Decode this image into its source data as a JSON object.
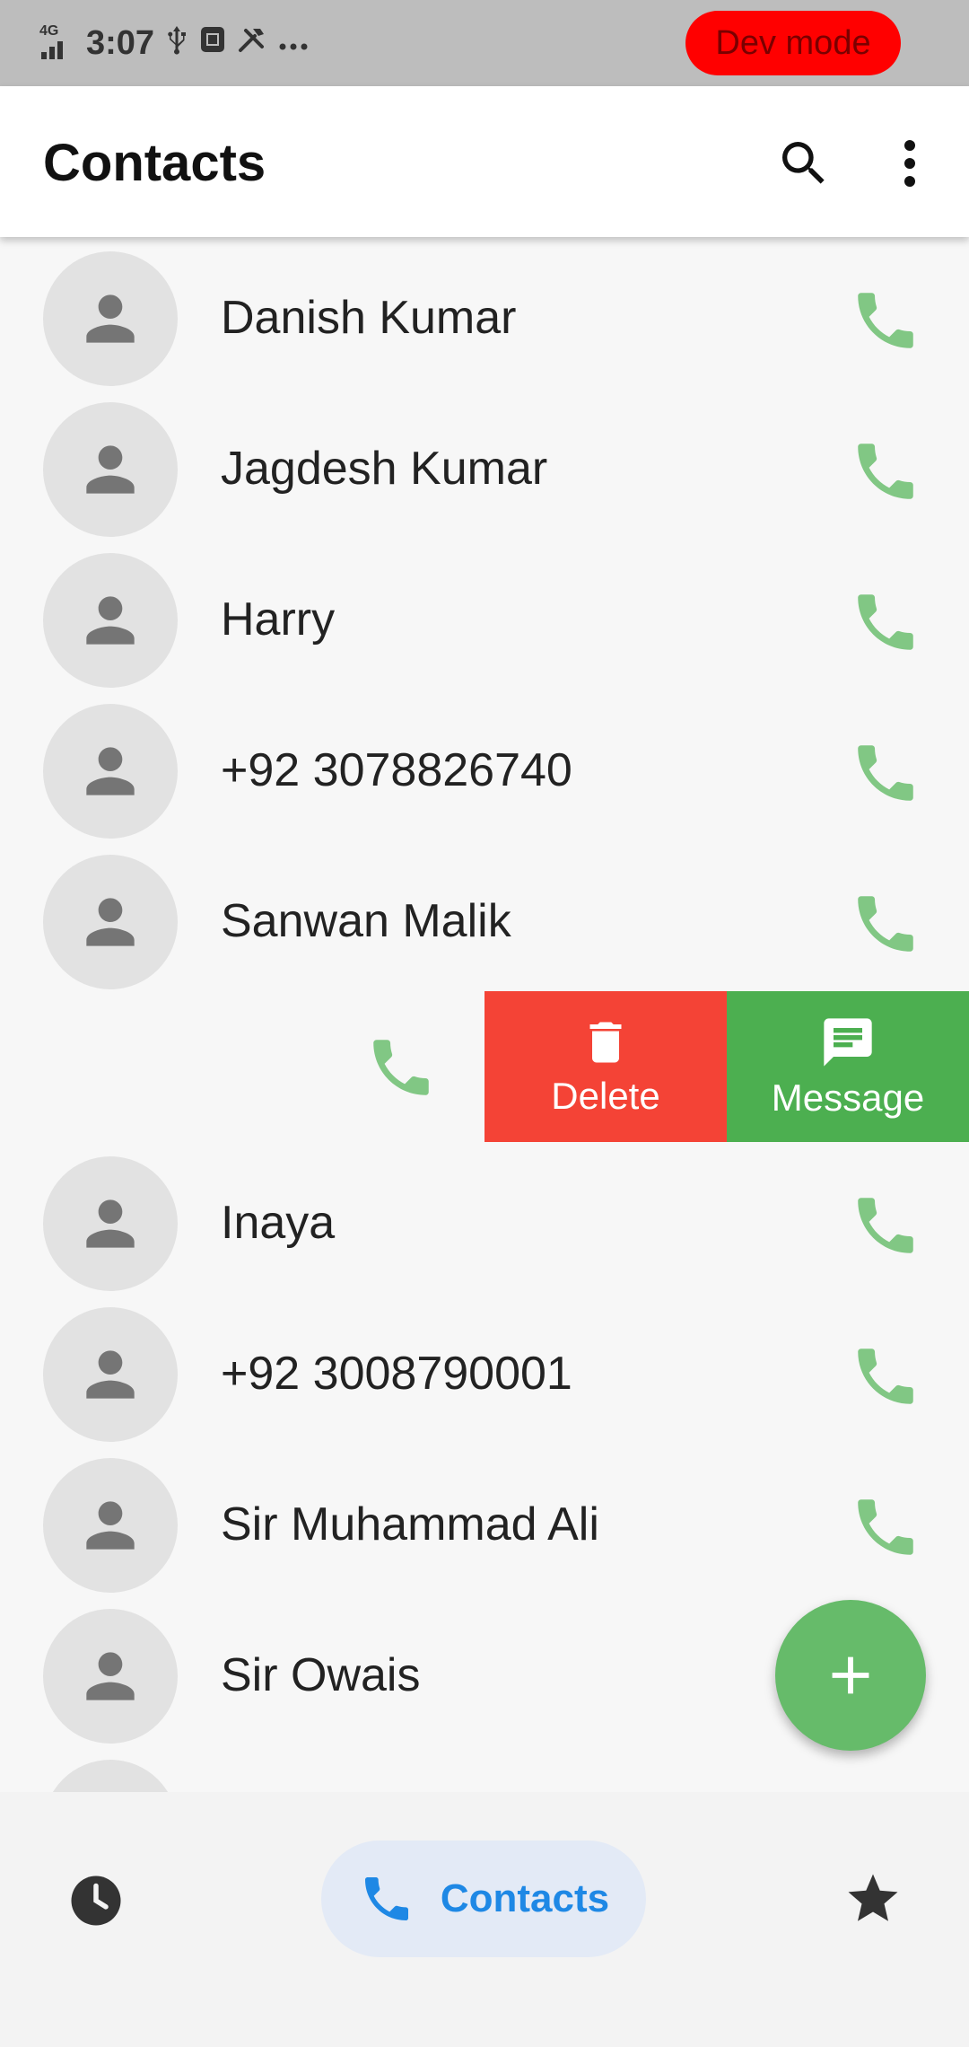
{
  "status_bar": {
    "network": "4G",
    "time": "3:07",
    "icons": [
      "usb-icon",
      "sim-icon",
      "tools-icon",
      "more-dots-icon"
    ],
    "dev_badge": "Dev mode"
  },
  "app_bar": {
    "title": "Contacts",
    "actions": [
      "search-icon",
      "more-vert-icon"
    ]
  },
  "contacts": [
    {
      "name": "Danish Kumar"
    },
    {
      "name": "Jagdesh Kumar"
    },
    {
      "name": "Harry"
    },
    {
      "name": "+92 3078826740"
    },
    {
      "name": "Sanwan Malik"
    },
    {
      "name": ""
    },
    {
      "name": "Inaya"
    },
    {
      "name": "+92 3008790001"
    },
    {
      "name": "Sir Muhammad Ali"
    },
    {
      "name": "Sir Owais"
    }
  ],
  "swipe_actions": {
    "delete_label": "Delete",
    "message_label": "Message"
  },
  "bottom_nav": {
    "items": [
      {
        "icon": "clock-icon",
        "label": ""
      },
      {
        "icon": "phone-icon",
        "label": "Contacts",
        "selected": true
      },
      {
        "icon": "star-icon",
        "label": ""
      }
    ]
  },
  "colors": {
    "accent": "#1e88e5",
    "call_green": "#81c784",
    "fab_green": "#66bb6a",
    "delete_red": "#f44336",
    "message_green": "#4caf50",
    "dev_badge": "#ff0000"
  }
}
